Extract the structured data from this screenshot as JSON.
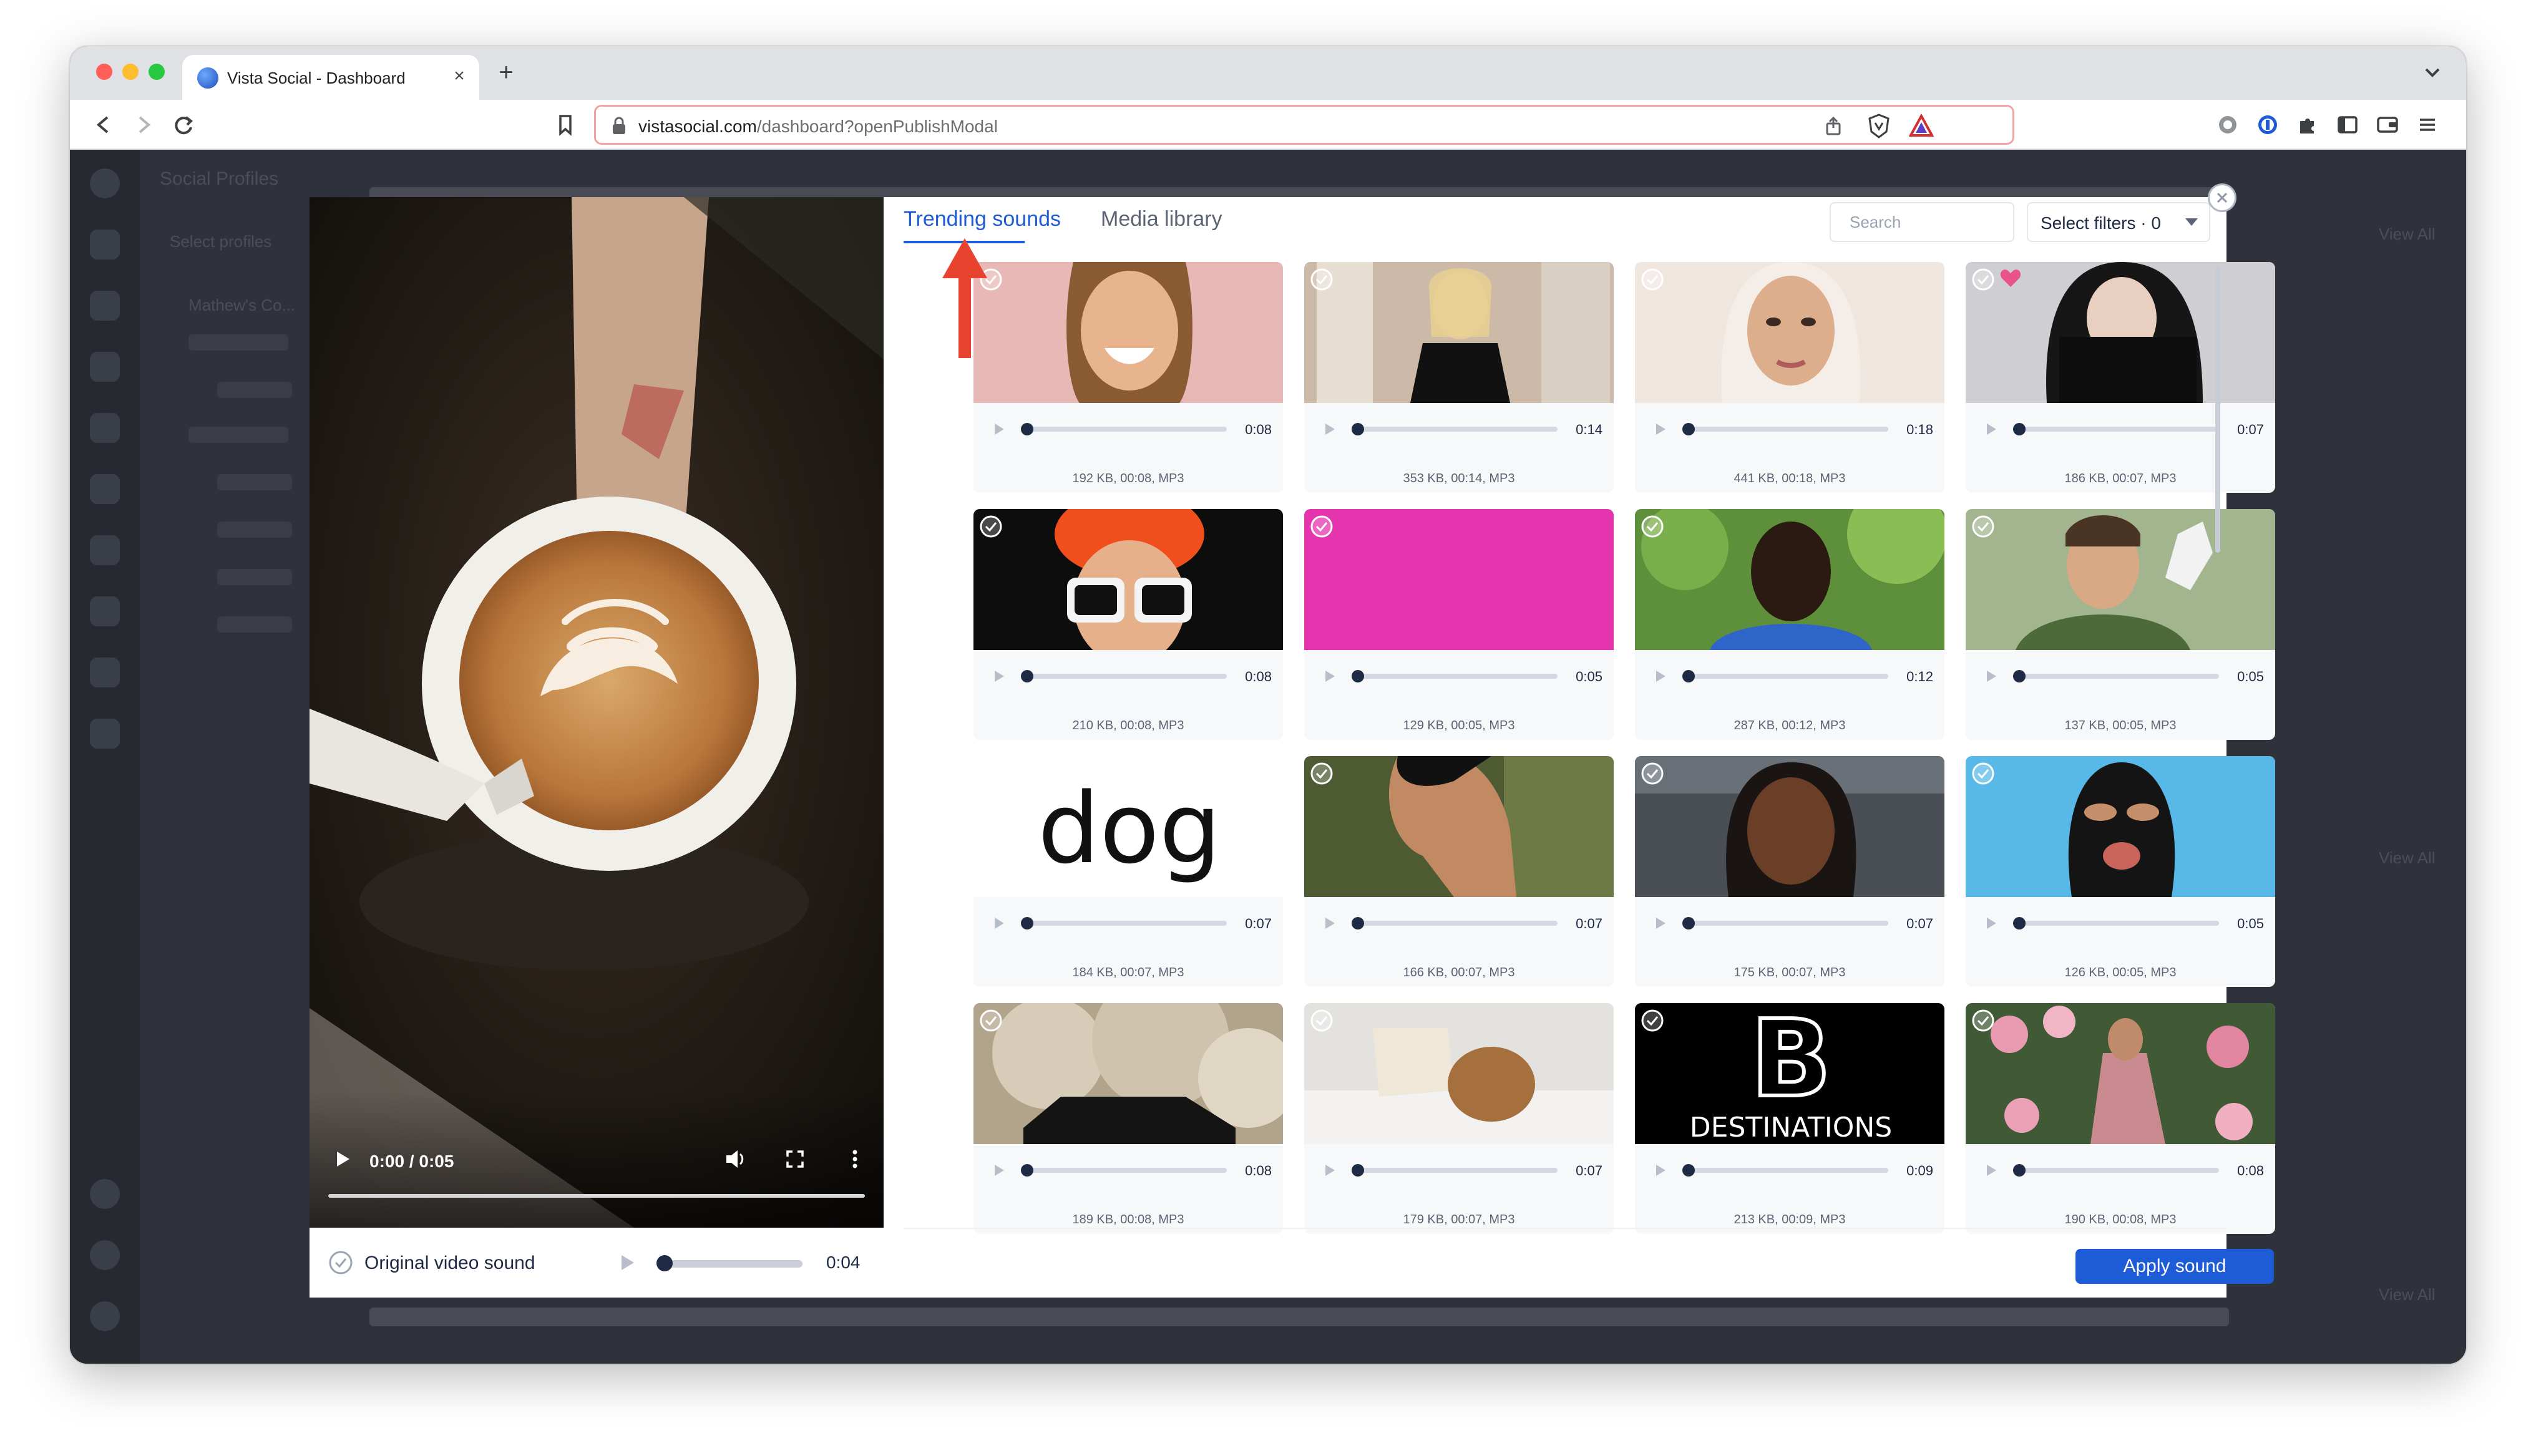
{
  "browser": {
    "tab_title": "Vista Social - Dashboard",
    "tab_close": "×",
    "new_tab": "+",
    "url_host": "vistasocial.com",
    "url_path": "/dashboard?openPublishModal"
  },
  "app": {
    "header_title": "Social Profiles",
    "select_label": "Select profiles",
    "group_label": "Mathew's Co...",
    "view_all_1": "View All",
    "view_all_2": "View All",
    "view_all_3": "View All"
  },
  "modal": {
    "tabs": [
      {
        "label": "Trending sounds",
        "active": true
      },
      {
        "label": "Media library",
        "active": false
      }
    ],
    "search_placeholder": "Search",
    "filter_label": "Select filters · 0",
    "video": {
      "time_display": "0:00 / 0:05",
      "progress": 0
    },
    "original": {
      "label": "Original video sound",
      "time": "0:04",
      "progress": 0
    },
    "apply_label": "Apply sound",
    "sounds": [
      {
        "duration": "0:08",
        "meta": "192 KB, 00:08, MP3",
        "thumb": "woman-smiling",
        "accent": "#e7b8b6"
      },
      {
        "duration": "0:14",
        "meta": "353 KB, 00:14, MP3",
        "thumb": "blonde-woman-boutique",
        "accent": "#cdb9a8"
      },
      {
        "duration": "0:18",
        "meta": "441 KB, 00:18, MP3",
        "thumb": "woman-headscarf",
        "accent": "#efe6e0"
      },
      {
        "duration": "0:07",
        "meta": "186 KB, 00:07, MP3",
        "thumb": "woman-covering-face",
        "accent": "#cfcfd3",
        "favorite": true
      },
      {
        "duration": "0:08",
        "meta": "210 KB, 00:08, MP3",
        "thumb": "orange-hair-sunglasses",
        "accent": "#0d0d0d"
      },
      {
        "duration": "0:05",
        "meta": "129 KB, 00:05, MP3",
        "thumb": "pink-background",
        "accent": "#e535ae"
      },
      {
        "duration": "0:12",
        "meta": "287 KB, 00:12, MP3",
        "thumb": "man-in-park",
        "accent": "#5e8f3a"
      },
      {
        "duration": "0:05",
        "meta": "137 KB, 00:05, MP3",
        "thumb": "man-waving",
        "accent": "#a3b58e"
      },
      {
        "duration": "0:07",
        "meta": "184 KB, 00:07, MP3",
        "thumb": "dog-logo",
        "accent": "#ffffff",
        "text": "dog"
      },
      {
        "duration": "0:07",
        "meta": "166 KB, 00:07, MP3",
        "thumb": "man-profile",
        "accent": "#4d5a32"
      },
      {
        "duration": "0:07",
        "meta": "175 KB, 00:07, MP3",
        "thumb": "woman-in-car",
        "accent": "#4a4f55"
      },
      {
        "duration": "0:05",
        "meta": "126 KB, 00:05, MP3",
        "thumb": "balaclava",
        "accent": "#58b8e8"
      },
      {
        "duration": "0:08",
        "meta": "189 KB, 00:08, MP3",
        "thumb": "car-smoke",
        "accent": "#b2a38b"
      },
      {
        "duration": "0:07",
        "meta": "179 KB, 00:07, MP3",
        "thumb": "woman-reading-in-bed",
        "accent": "#e4e2df"
      },
      {
        "duration": "0:09",
        "meta": "213 KB, 00:09, MP3",
        "thumb": "destinations-logo",
        "accent": "#000000",
        "text": "DESTINATIONS"
      },
      {
        "duration": "0:08",
        "meta": "190 KB, 00:08, MP3",
        "thumb": "woman-with-flowers",
        "accent": "#c98a90"
      }
    ]
  },
  "colors": {
    "primary": "#1e5bd7",
    "arrow": "#e8432e",
    "text_dark": "#1f2a44"
  }
}
